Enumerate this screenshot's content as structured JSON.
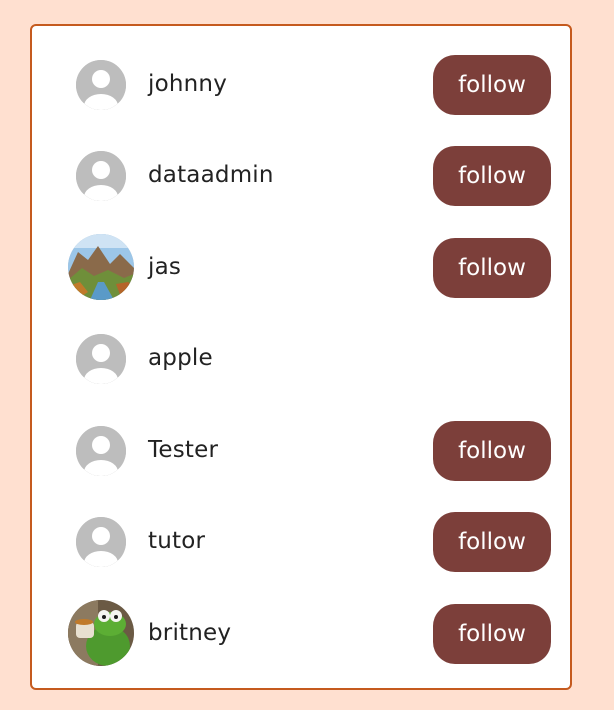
{
  "colors": {
    "page_background": "#ffe0d0",
    "card_border": "#c55a1e",
    "button_background": "#7c3f3a",
    "button_text": "#ffffff",
    "username_text": "#222222",
    "placeholder_avatar": "#bdbdbd"
  },
  "users": [
    {
      "name": "johnny",
      "avatar": "default-avatar-icon",
      "follow_label": "follow"
    },
    {
      "name": "dataadmin",
      "avatar": "default-avatar-icon",
      "follow_label": "follow"
    },
    {
      "name": "jas",
      "avatar": "landscape-photo-avatar",
      "follow_label": "follow"
    },
    {
      "name": "apple",
      "avatar": "default-avatar-icon",
      "follow_label": null
    },
    {
      "name": "Tester",
      "avatar": "default-avatar-icon",
      "follow_label": "follow"
    },
    {
      "name": "tutor",
      "avatar": "default-avatar-icon",
      "follow_label": "follow"
    },
    {
      "name": "britney",
      "avatar": "kermit-photo-avatar",
      "follow_label": "follow"
    }
  ]
}
